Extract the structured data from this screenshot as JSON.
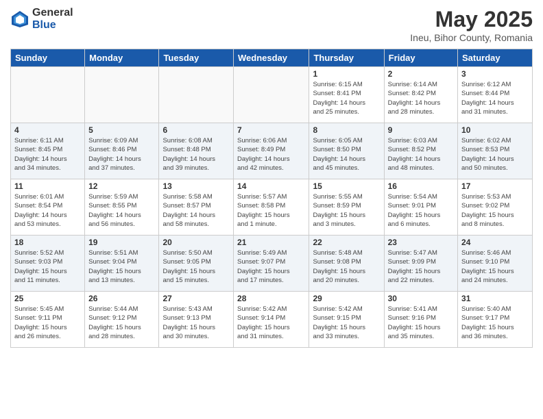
{
  "logo": {
    "general": "General",
    "blue": "Blue"
  },
  "title": "May 2025",
  "location": "Ineu, Bihor County, Romania",
  "days_of_week": [
    "Sunday",
    "Monday",
    "Tuesday",
    "Wednesday",
    "Thursday",
    "Friday",
    "Saturday"
  ],
  "weeks": [
    [
      {
        "day": "",
        "info": ""
      },
      {
        "day": "",
        "info": ""
      },
      {
        "day": "",
        "info": ""
      },
      {
        "day": "",
        "info": ""
      },
      {
        "day": "1",
        "info": "Sunrise: 6:15 AM\nSunset: 8:41 PM\nDaylight: 14 hours\nand 25 minutes."
      },
      {
        "day": "2",
        "info": "Sunrise: 6:14 AM\nSunset: 8:42 PM\nDaylight: 14 hours\nand 28 minutes."
      },
      {
        "day": "3",
        "info": "Sunrise: 6:12 AM\nSunset: 8:44 PM\nDaylight: 14 hours\nand 31 minutes."
      }
    ],
    [
      {
        "day": "4",
        "info": "Sunrise: 6:11 AM\nSunset: 8:45 PM\nDaylight: 14 hours\nand 34 minutes."
      },
      {
        "day": "5",
        "info": "Sunrise: 6:09 AM\nSunset: 8:46 PM\nDaylight: 14 hours\nand 37 minutes."
      },
      {
        "day": "6",
        "info": "Sunrise: 6:08 AM\nSunset: 8:48 PM\nDaylight: 14 hours\nand 39 minutes."
      },
      {
        "day": "7",
        "info": "Sunrise: 6:06 AM\nSunset: 8:49 PM\nDaylight: 14 hours\nand 42 minutes."
      },
      {
        "day": "8",
        "info": "Sunrise: 6:05 AM\nSunset: 8:50 PM\nDaylight: 14 hours\nand 45 minutes."
      },
      {
        "day": "9",
        "info": "Sunrise: 6:03 AM\nSunset: 8:52 PM\nDaylight: 14 hours\nand 48 minutes."
      },
      {
        "day": "10",
        "info": "Sunrise: 6:02 AM\nSunset: 8:53 PM\nDaylight: 14 hours\nand 50 minutes."
      }
    ],
    [
      {
        "day": "11",
        "info": "Sunrise: 6:01 AM\nSunset: 8:54 PM\nDaylight: 14 hours\nand 53 minutes."
      },
      {
        "day": "12",
        "info": "Sunrise: 5:59 AM\nSunset: 8:55 PM\nDaylight: 14 hours\nand 56 minutes."
      },
      {
        "day": "13",
        "info": "Sunrise: 5:58 AM\nSunset: 8:57 PM\nDaylight: 14 hours\nand 58 minutes."
      },
      {
        "day": "14",
        "info": "Sunrise: 5:57 AM\nSunset: 8:58 PM\nDaylight: 15 hours\nand 1 minute."
      },
      {
        "day": "15",
        "info": "Sunrise: 5:55 AM\nSunset: 8:59 PM\nDaylight: 15 hours\nand 3 minutes."
      },
      {
        "day": "16",
        "info": "Sunrise: 5:54 AM\nSunset: 9:01 PM\nDaylight: 15 hours\nand 6 minutes."
      },
      {
        "day": "17",
        "info": "Sunrise: 5:53 AM\nSunset: 9:02 PM\nDaylight: 15 hours\nand 8 minutes."
      }
    ],
    [
      {
        "day": "18",
        "info": "Sunrise: 5:52 AM\nSunset: 9:03 PM\nDaylight: 15 hours\nand 11 minutes."
      },
      {
        "day": "19",
        "info": "Sunrise: 5:51 AM\nSunset: 9:04 PM\nDaylight: 15 hours\nand 13 minutes."
      },
      {
        "day": "20",
        "info": "Sunrise: 5:50 AM\nSunset: 9:05 PM\nDaylight: 15 hours\nand 15 minutes."
      },
      {
        "day": "21",
        "info": "Sunrise: 5:49 AM\nSunset: 9:07 PM\nDaylight: 15 hours\nand 17 minutes."
      },
      {
        "day": "22",
        "info": "Sunrise: 5:48 AM\nSunset: 9:08 PM\nDaylight: 15 hours\nand 20 minutes."
      },
      {
        "day": "23",
        "info": "Sunrise: 5:47 AM\nSunset: 9:09 PM\nDaylight: 15 hours\nand 22 minutes."
      },
      {
        "day": "24",
        "info": "Sunrise: 5:46 AM\nSunset: 9:10 PM\nDaylight: 15 hours\nand 24 minutes."
      }
    ],
    [
      {
        "day": "25",
        "info": "Sunrise: 5:45 AM\nSunset: 9:11 PM\nDaylight: 15 hours\nand 26 minutes."
      },
      {
        "day": "26",
        "info": "Sunrise: 5:44 AM\nSunset: 9:12 PM\nDaylight: 15 hours\nand 28 minutes."
      },
      {
        "day": "27",
        "info": "Sunrise: 5:43 AM\nSunset: 9:13 PM\nDaylight: 15 hours\nand 30 minutes."
      },
      {
        "day": "28",
        "info": "Sunrise: 5:42 AM\nSunset: 9:14 PM\nDaylight: 15 hours\nand 31 minutes."
      },
      {
        "day": "29",
        "info": "Sunrise: 5:42 AM\nSunset: 9:15 PM\nDaylight: 15 hours\nand 33 minutes."
      },
      {
        "day": "30",
        "info": "Sunrise: 5:41 AM\nSunset: 9:16 PM\nDaylight: 15 hours\nand 35 minutes."
      },
      {
        "day": "31",
        "info": "Sunrise: 5:40 AM\nSunset: 9:17 PM\nDaylight: 15 hours\nand 36 minutes."
      }
    ]
  ]
}
